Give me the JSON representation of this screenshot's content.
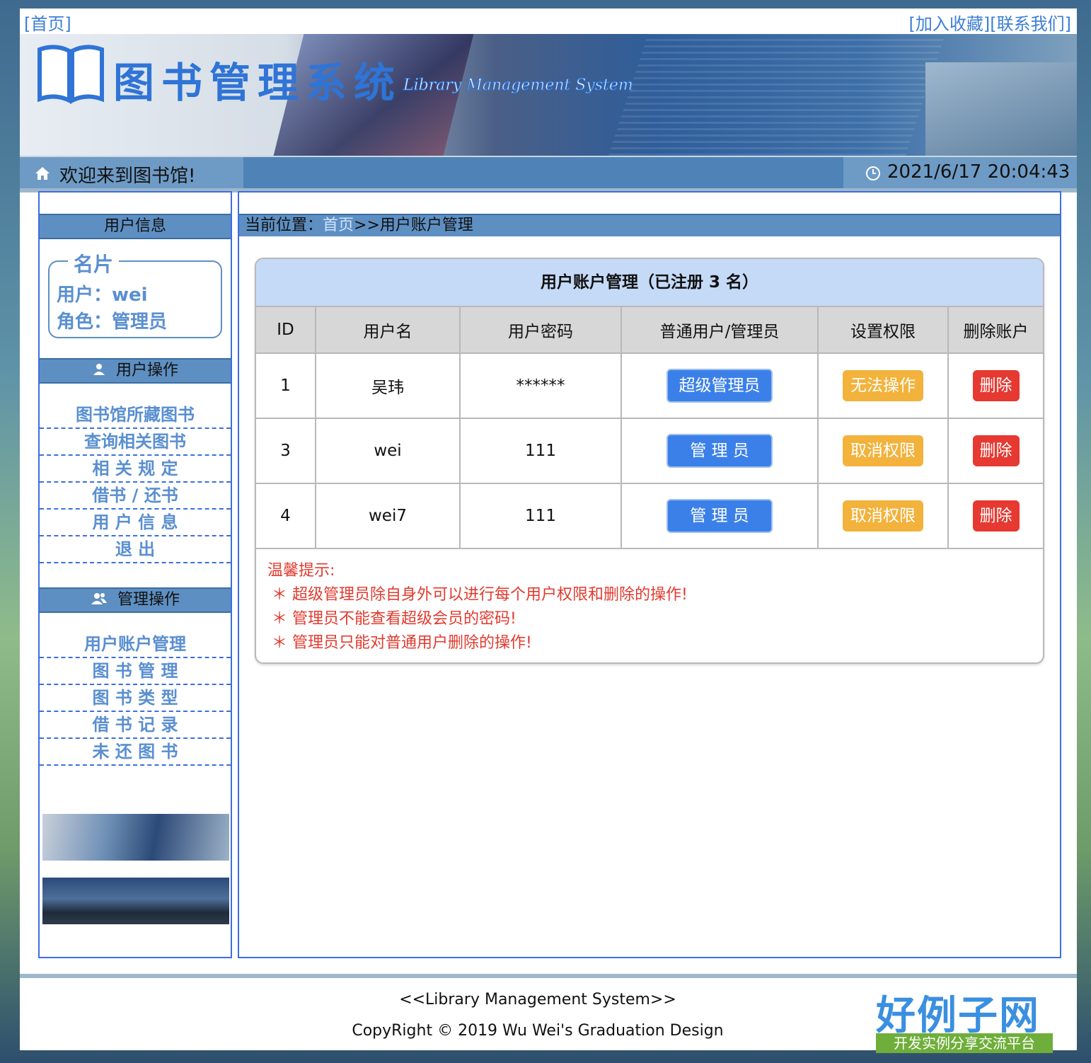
{
  "top_links": {
    "home": "[首页]",
    "favorite": "[加入收藏]",
    "contact": "[联系我们]"
  },
  "banner": {
    "title": "图书管理系统",
    "subtitle": "Library Management System"
  },
  "welcome_bar": {
    "welcome": "欢迎来到图书馆!",
    "datetime": "2021/6/17 20:04:43"
  },
  "sidebar": {
    "user_info_header": "用户信息",
    "card_title": "名片",
    "user_line": "用户：wei",
    "role_line": "角色：管理员",
    "user_ops_header": "用户操作",
    "user_ops": [
      "图书馆所藏图书",
      "查询相关图书",
      "相 关 规 定",
      "借书 / 还书",
      "用 户 信 息",
      "退   出"
    ],
    "admin_ops_header": "管理操作",
    "admin_ops": [
      "用户账户管理",
      "图 书 管 理",
      "图 书 类 型",
      "借 书 记 录",
      "未 还 图 书"
    ]
  },
  "breadcrumb": {
    "prefix": "当前位置：",
    "home": "首页",
    "current": ">>用户账户管理"
  },
  "panel": {
    "title": "用户账户管理（已注册 3 名）",
    "columns": [
      "ID",
      "用户名",
      "用户密码",
      "普通用户/管理员",
      "设置权限",
      "删除账户"
    ],
    "rows": [
      {
        "id": "1",
        "username": "吴玮",
        "password": "******",
        "role": "超级管理员",
        "permission": "无法操作",
        "delete": "删除"
      },
      {
        "id": "3",
        "username": "wei",
        "password": "111",
        "role": "管 理 员",
        "permission": "取消权限",
        "delete": "删除"
      },
      {
        "id": "4",
        "username": "wei7",
        "password": "111",
        "role": "管 理 员",
        "permission": "取消权限",
        "delete": "删除"
      }
    ],
    "tips_title": "温馨提示:",
    "tips": [
      "＊ 超级管理员除自身外可以进行每个用户权限和删除的操作!",
      "＊ 管理员不能查看超级会员的密码!",
      "＊ 管理员只能对普通用户删除的操作!"
    ]
  },
  "footer": {
    "line1": "<<Library Management System>>",
    "line2": "CopyRight © 2019  Wu Wei's Graduation Design",
    "logo": "好例子网",
    "logo_sub": "开发实例分享交流平台"
  },
  "colors": {
    "link": "#3c7fd6",
    "header_bar": "#5e8fc2",
    "table_title_bg": "#c5daf7",
    "btn_blue": "#3b80e8",
    "btn_orange": "#f2b23b",
    "btn_red": "#e53931",
    "tips_red": "#e23a2e"
  },
  "icons": [
    "book-logo-icon",
    "house-icon",
    "clock-icon",
    "user-icon",
    "users-icon"
  ]
}
